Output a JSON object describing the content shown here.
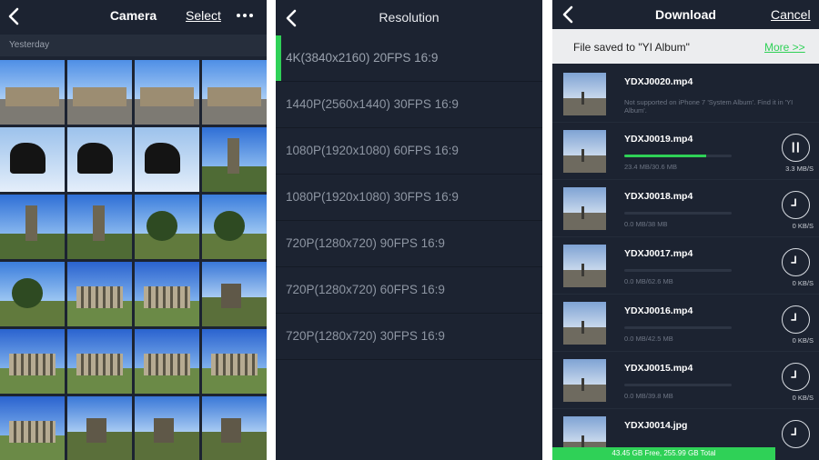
{
  "camera": {
    "title": "Camera",
    "select_label": "Select",
    "section_label": "Yesterday",
    "thumbnails": [
      "fountain",
      "fountain",
      "fountain",
      "fountain",
      "statue",
      "statue",
      "statue",
      "tower",
      "tower",
      "tower",
      "tree",
      "tree",
      "tree",
      "temple",
      "temple",
      "hill",
      "temple",
      "temple",
      "temple",
      "temple",
      "temple",
      "hill",
      "hill",
      "hill"
    ]
  },
  "resolution": {
    "title": "Resolution",
    "selected_index": 0,
    "accent_color": "#2fd157",
    "options": [
      "4K(3840x2160) 20FPS 16:9",
      "1440P(2560x1440) 30FPS 16:9",
      "1080P(1920x1080) 60FPS 16:9",
      "1080P(1920x1080) 30FPS 16:9",
      "720P(1280x720) 90FPS 16:9",
      "720P(1280x720) 60FPS 16:9",
      "720P(1280x720) 30FPS 16:9"
    ]
  },
  "download": {
    "title": "Download",
    "cancel_label": "Cancel",
    "banner_text": "File saved to \"YI Album\"",
    "banner_more": "More >>",
    "items": [
      {
        "name": "YDXJ0020.mp4",
        "note": "Not supported on iPhone 7 'System Album'. Find it in 'YI Album'.",
        "state": "done"
      },
      {
        "name": "YDXJ0019.mp4",
        "size": "23.4 MB/30.6 MB",
        "progress": 0.765,
        "speed": "3.3 MB/S",
        "state": "downloading"
      },
      {
        "name": "YDXJ0018.mp4",
        "size": "0.0 MB/38 MB",
        "progress": 0,
        "speed": "0 KB/S",
        "state": "waiting"
      },
      {
        "name": "YDXJ0017.mp4",
        "size": "0.0 MB/62.6 MB",
        "progress": 0,
        "speed": "0 KB/S",
        "state": "waiting"
      },
      {
        "name": "YDXJ0016.mp4",
        "size": "0.0 MB/42.5 MB",
        "progress": 0,
        "speed": "0 KB/S",
        "state": "waiting"
      },
      {
        "name": "YDXJ0015.mp4",
        "size": "0.0 MB/39.8 MB",
        "progress": 0,
        "speed": "0 KB/S",
        "state": "waiting"
      },
      {
        "name": "YDXJ0014.jpg",
        "state": "waiting"
      }
    ],
    "footer_text": "43.45 GB Free, 255.99 GB Total"
  },
  "icons": {
    "back": "chevron-left-icon",
    "more": "ellipsis-icon",
    "pause": "pause-icon",
    "clock": "clock-icon"
  }
}
